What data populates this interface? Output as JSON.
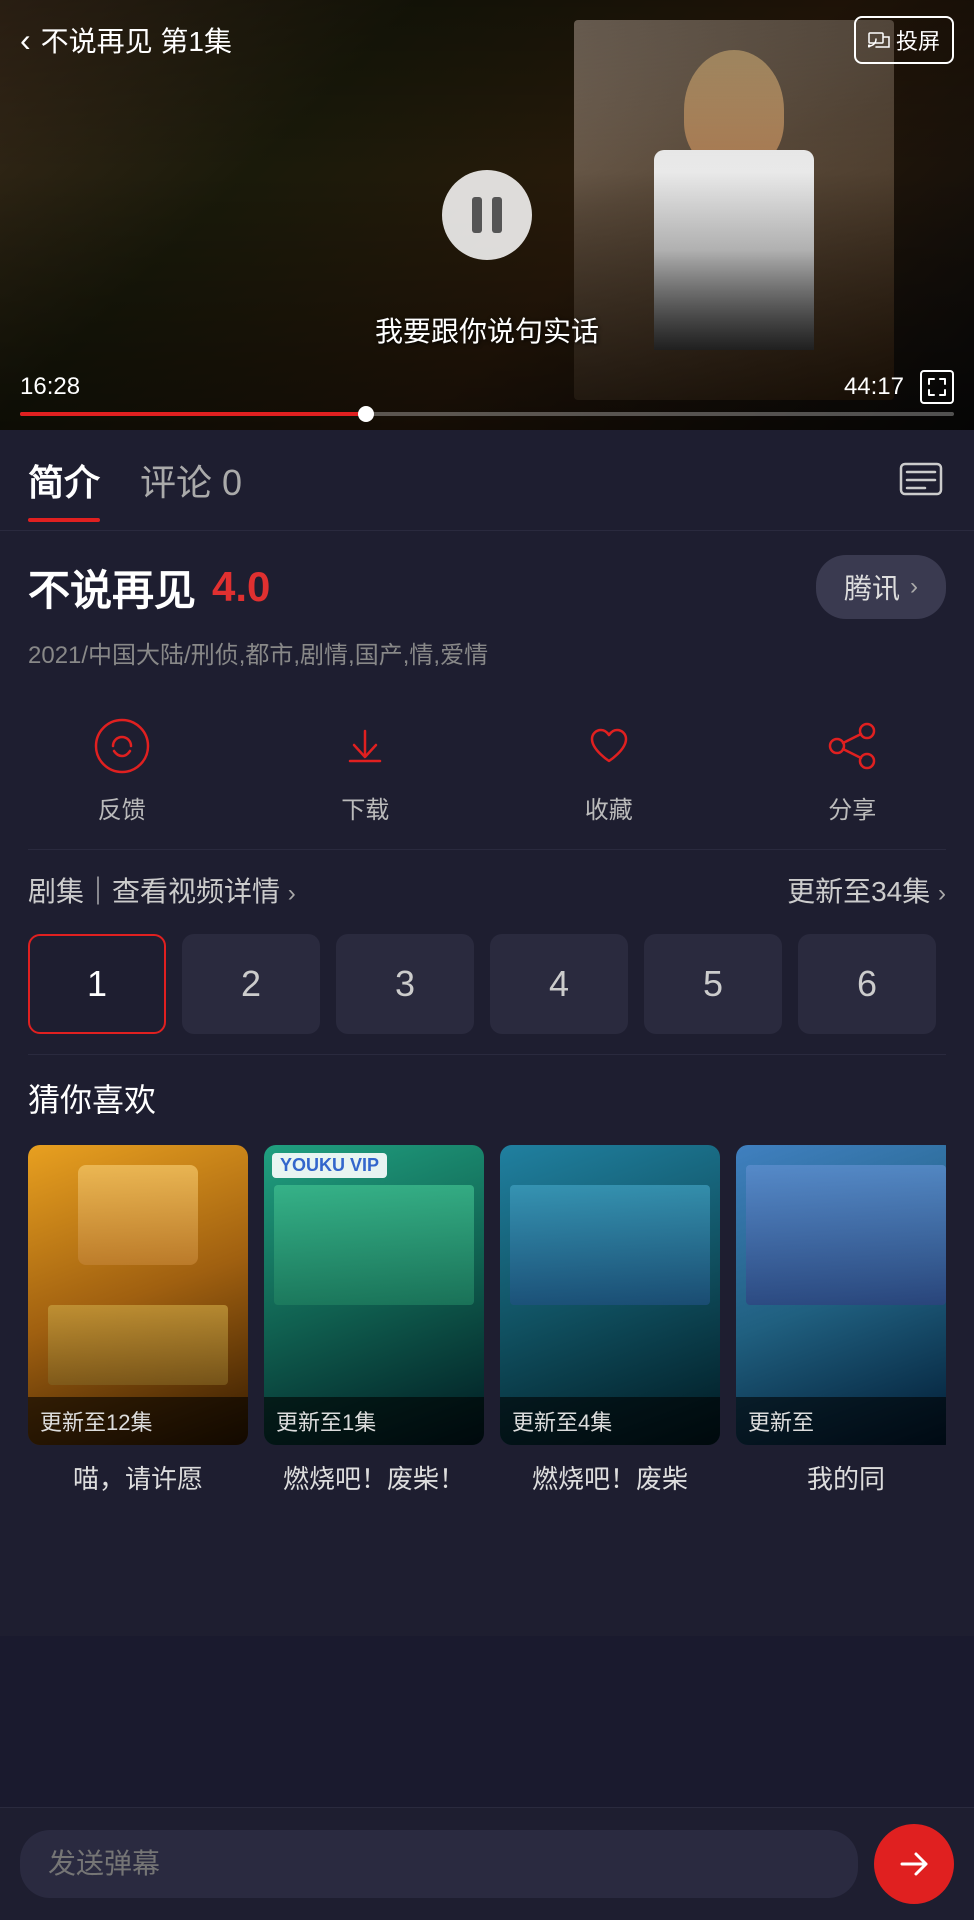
{
  "video": {
    "title": "不说再见 第1集",
    "current_time": "16:28",
    "total_time": "44:17",
    "progress_percent": 37,
    "subtitle": "我要跟你说句实话",
    "cast_label": "投屏",
    "pause_label": "pause"
  },
  "tabs": {
    "intro_label": "简介",
    "comment_label": "评论",
    "comment_count": "0"
  },
  "show": {
    "name": "不说再见",
    "rating": "4.0",
    "platform": "腾讯",
    "meta": "2021/中国大陆/刑侦,都市,剧情,国产,情,爱情"
  },
  "actions": [
    {
      "id": "feedback",
      "label": "反馈"
    },
    {
      "id": "download",
      "label": "下载"
    },
    {
      "id": "favorite",
      "label": "收藏"
    },
    {
      "id": "share",
      "label": "分享"
    }
  ],
  "episodes": {
    "section_label": "剧集｜查看视频详情",
    "update_label": "更新至34集",
    "items": [
      "1",
      "2",
      "3",
      "4",
      "5",
      "6"
    ],
    "active_index": 0
  },
  "recommend": {
    "section_label": "猜你喜欢",
    "items": [
      {
        "name": "喵，请许愿",
        "badge": "更新至12集",
        "has_youku": false
      },
      {
        "name": "燃烧吧！废柴！",
        "badge": "更新至1集",
        "has_youku": true
      },
      {
        "name": "燃烧吧！废柴",
        "badge": "更新至4集",
        "has_youku": false
      },
      {
        "name": "我的同",
        "badge": "更新至",
        "has_youku": false
      }
    ]
  },
  "bottom": {
    "danmu_placeholder": "发送弹幕",
    "send_label": "发送"
  }
}
